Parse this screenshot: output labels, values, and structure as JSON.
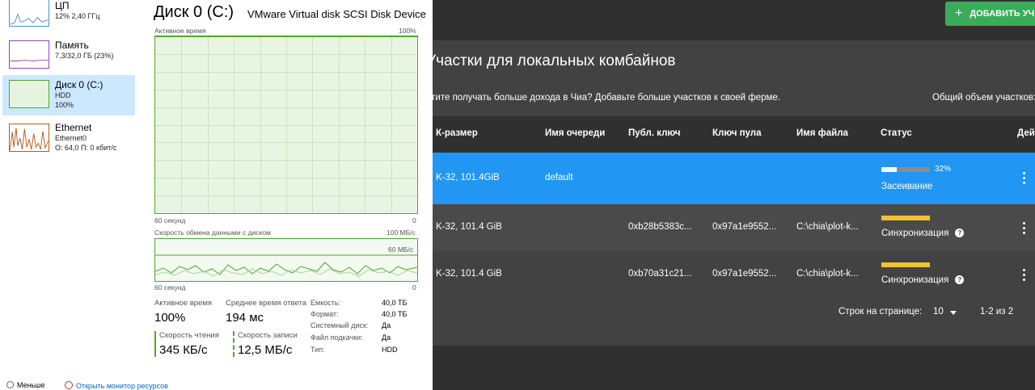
{
  "task_manager": {
    "sidebar": [
      {
        "title": "ЦП",
        "line2": "12% 2,40 ГГц",
        "line3": ""
      },
      {
        "title": "Память",
        "line2": "7,3/32,0 ГБ (23%)",
        "line3": ""
      },
      {
        "title": "Диск 0 (C:)",
        "line2": "HDD",
        "line3": "100%"
      },
      {
        "title": "Ethernet",
        "line2": "Ethernet0",
        "line3": "О: 64,0 П: 0 кбит/с"
      }
    ],
    "header": {
      "title": "Диск 0 (C:)",
      "model": "VMware Virtual disk SCSI Disk Device"
    },
    "graph1": {
      "label": "Активное время",
      "max_label": "100%",
      "x_label": "60 секунд",
      "min_label": "0",
      "active_percent": 100
    },
    "graph2": {
      "label": "Скорость обмена данными с диском",
      "max_label": "100 МБ/с",
      "inner_label": "60 МБ/с",
      "x_label": "60 секунд",
      "min_label": "0"
    },
    "stats": {
      "active_time_label": "Активное время",
      "active_time_value": "100%",
      "avg_response_label": "Среднее время ответа",
      "avg_response_value": "194 мс",
      "read_label": "Скорость чтения",
      "read_value": "345 КБ/с",
      "write_label": "Скорость записи",
      "write_value": "12,5 МБ/с"
    },
    "props": [
      {
        "label": "Емкость:",
        "value": "40,0 ТБ"
      },
      {
        "label": "Формат:",
        "value": "40,0 ТБ"
      },
      {
        "label": "Системный диск:",
        "value": "Да"
      },
      {
        "label": "Файл подкачки:",
        "value": "Да"
      },
      {
        "label": "Тип:",
        "value": "HDD"
      }
    ],
    "footer": {
      "fewer": "Меньше",
      "open_monitor": "Открыть монитор ресурсов"
    }
  },
  "chia": {
    "add_button": "ДОБАВИТЬ УЧ",
    "section_title": "Участки для локальных комбайнов",
    "description": "отите получать больше дохода в Чиа? Добавьте больше участков к своей ферме.",
    "total_label": "Общий объем участков:",
    "columns": [
      "К-размер",
      "Имя очереди",
      "Публ. ключ",
      "Ключ пула",
      "Имя файла",
      "Статус",
      "Дей"
    ],
    "rows": [
      {
        "k_size": "K-32, 101.4GiB",
        "queue": "default",
        "pub_key": "",
        "pool_key": "",
        "filename": "",
        "status": "Засеивание",
        "progress_text": "32%",
        "progress": 0.32,
        "selected": true
      },
      {
        "k_size": "K-32, 101.4 GiB",
        "queue": "",
        "pub_key": "0xb28b5383c...",
        "pool_key": "0x97a1e9552...",
        "filename": "C:\\chia\\plot-k...",
        "status": "Синхронизация",
        "progress_text": "",
        "progress": 1,
        "selected": false
      },
      {
        "k_size": "K-32, 101.4 GiB",
        "queue": "",
        "pub_key": "0xb70a31c21...",
        "pool_key": "0x97a1e9552...",
        "filename": "C:\\chia\\plot-k...",
        "status": "Синхронизация",
        "progress_text": "",
        "progress": 1,
        "selected": false
      }
    ],
    "help_glyph": "?",
    "pagination": {
      "rows_per_page_label": "Строк на странице:",
      "rows_per_page": "10",
      "range": "1-2 из 2"
    },
    "colors": {
      "selected_row": "#2196f3",
      "sync_bar": "#f1c232",
      "progress_fill": "#ffffff",
      "progress_track": "#8c8c8c",
      "add_button": "#3aac59"
    }
  }
}
